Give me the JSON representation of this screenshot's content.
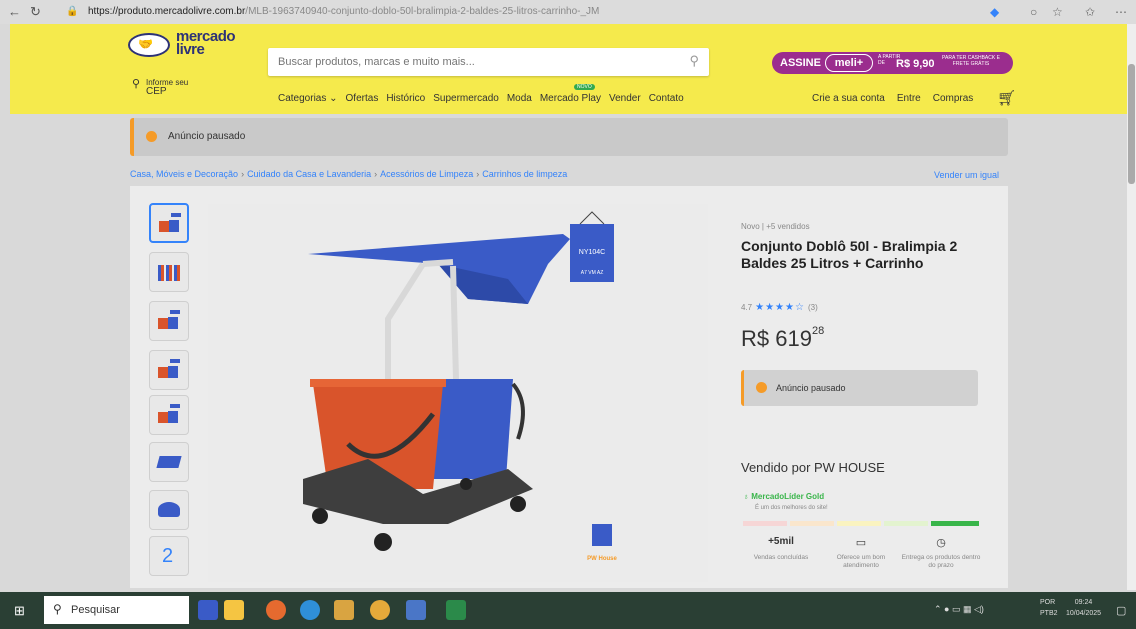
{
  "browser": {
    "url_host": "https://produto.mercadolivre.com.br",
    "url_rest": "/MLB-1963740940-conjunto-doblo-50l-bralimpia-2-baldes-25-litros-carrinho-_JM"
  },
  "header": {
    "logo_text": "mercado livre",
    "search_placeholder": "Buscar produtos, marcas e muito mais...",
    "meli": {
      "assine": "ASSINE",
      "plus": "meli+",
      "from_label": "A PARTIR DE",
      "price": "R$ 9,90",
      "cashback": "PARA TER CASHBACK E FRETE GRÁTIS"
    },
    "cep": {
      "line1": "Informe seu",
      "line2": "CEP"
    },
    "nav": [
      "Categorias ⌄",
      "Ofertas",
      "Histórico",
      "Supermercado",
      "Moda",
      "Mercado Play",
      "Vender",
      "Contato"
    ],
    "nav_badge": "NOVO",
    "user_nav": [
      "Crie a sua conta",
      "Entre",
      "Compras"
    ]
  },
  "banner": {
    "text": "Anúncio pausado"
  },
  "breadcrumb": [
    "Casa, Móveis e Decoração",
    "Cuidado da Casa e Lavanderia",
    "Acessórios de Limpeza",
    "Carrinhos de limpeza"
  ],
  "breadcrumb_sep": "›",
  "sell_similar": "Vender um igual",
  "gallery": {
    "more_count": "2",
    "tag_text1": "NY104C",
    "tag_text2": "A7 VM AZ",
    "logo_text": "PW House"
  },
  "product": {
    "condition": "Novo | +5 vendidos",
    "title": "Conjunto Doblô 50l - Bralimpia 2 Baldes 25 Litros + Carrinho",
    "rating": "4.7",
    "stars": "★★★★☆",
    "reviews": "(3)",
    "price_main": "R$ 619",
    "price_cents": "28",
    "paused": "Anúncio pausado"
  },
  "seller": {
    "title": "Vendido por PW HOUSE",
    "medal": "MercadoLíder Gold",
    "medal_sub": "É um dos melhores do site!",
    "reputation_level": 5,
    "stats": [
      {
        "value": "+5mil",
        "icon": "chat-icon",
        "label": "Vendas concluídas"
      },
      {
        "value": "",
        "icon": "chat-icon",
        "label": "Oferece um bom atendimento"
      },
      {
        "value": "",
        "icon": "clock-icon",
        "label": "Entrega os produtos dentro do prazo"
      }
    ]
  },
  "taskbar": {
    "search": "Pesquisar",
    "lang1": "POR",
    "lang2": "PTB2",
    "time": "09:24",
    "date": "10/04/2025"
  },
  "colors": {
    "header_yellow": "#f5ea4c",
    "brand_blue": "#2d3277",
    "link_blue": "#3483fa",
    "meli_purple": "#9b2d8e",
    "pause_orange": "#f59b28",
    "green": "#39b54a"
  }
}
